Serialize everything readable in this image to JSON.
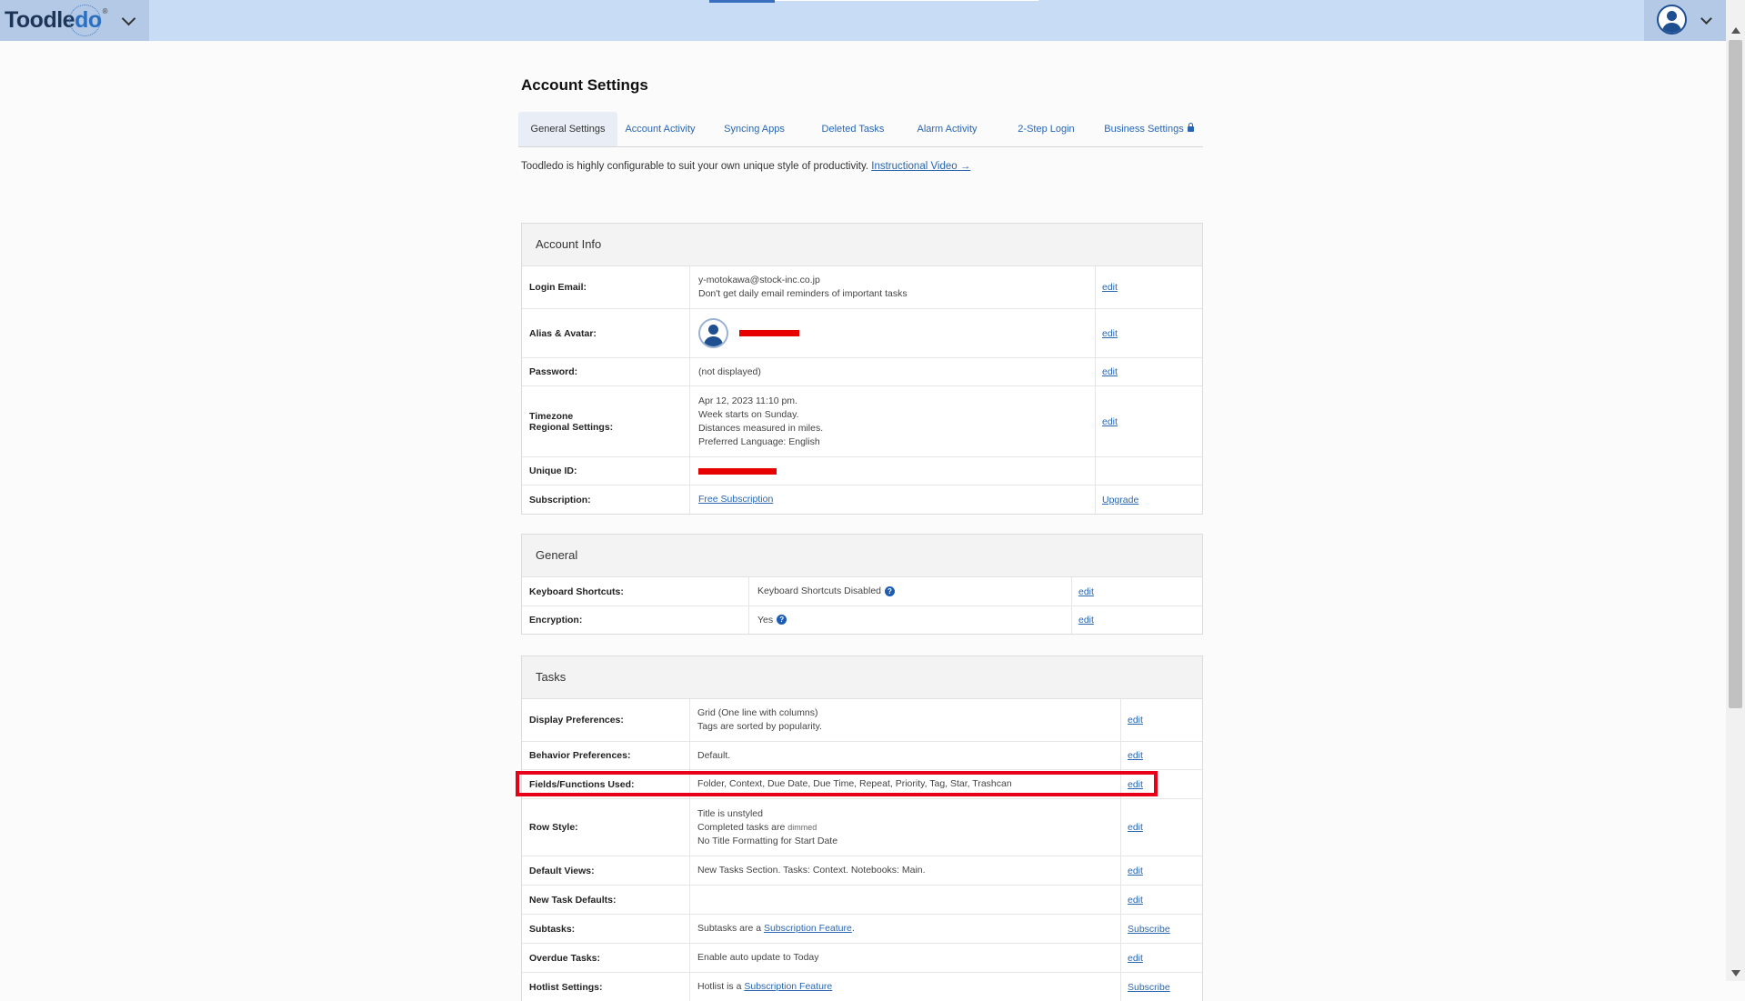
{
  "brand": {
    "name_part1": "Toodle",
    "name_part2": "do",
    "tm": "®"
  },
  "page": {
    "title": "Account Settings",
    "intro_text": "Toodledo is highly configurable to suit your own unique style of productivity.",
    "intro_link": "Instructional Video →"
  },
  "tabs": [
    {
      "label": "General Settings",
      "active": true
    },
    {
      "label": "Account Activity"
    },
    {
      "label": "Syncing Apps"
    },
    {
      "label": "Deleted Tasks"
    },
    {
      "label": "Alarm Activity"
    },
    {
      "label": "2-Step Login"
    },
    {
      "label": "Business Settings",
      "icon": "lock-icon"
    }
  ],
  "account_info": {
    "header": "Account Info",
    "rows": {
      "login_email": {
        "label": "Login Email:",
        "line1": "y-motokawa@stock-inc.co.jp",
        "line2": "Don't get daily email reminders of important tasks",
        "action": "edit"
      },
      "alias": {
        "label": "Alias & Avatar:",
        "action": "edit"
      },
      "password": {
        "label": "Password:",
        "value": "(not displayed)",
        "action": "edit"
      },
      "timezone": {
        "label1": "Timezone",
        "label2": "Regional Settings:",
        "line1": "Apr 12, 2023 11:10 pm.",
        "line2": "Week starts on Sunday.",
        "line3": "Distances measured in miles.",
        "line4": "Preferred Language: English",
        "action": "edit"
      },
      "unique_id": {
        "label": "Unique ID:"
      },
      "subscription": {
        "label": "Subscription:",
        "value": "Free Subscription",
        "action": "Upgrade"
      }
    }
  },
  "general": {
    "header": "General",
    "rows": {
      "keyboard": {
        "label": "Keyboard Shortcuts:",
        "value": "Keyboard Shortcuts Disabled",
        "action": "edit"
      },
      "encryption": {
        "label": "Encryption:",
        "value": "Yes",
        "action": "edit"
      }
    }
  },
  "tasks": {
    "header": "Tasks",
    "rows": {
      "display": {
        "label": "Display Preferences:",
        "line1": "Grid (One line with columns)",
        "line2": "Tags are sorted by popularity.",
        "action": "edit"
      },
      "behavior": {
        "label": "Behavior Preferences:",
        "value": "Default.",
        "action": "edit"
      },
      "fields": {
        "label": "Fields/Functions Used:",
        "value": "Folder, Context, Due Date, Due Time, Repeat, Priority, Tag, Star, Trashcan",
        "action": "edit"
      },
      "row_style": {
        "label": "Row Style:",
        "line1": "Title is unstyled",
        "line2_prefix": "Completed tasks are",
        "line2_dim": "dimmed",
        "line3": "No Title Formatting for Start Date",
        "action": "edit"
      },
      "default_views": {
        "label": "Default Views:",
        "value": "New Tasks Section. Tasks: Context. Notebooks: Main.",
        "action": "edit"
      },
      "new_task": {
        "label": "New Task Defaults:",
        "action": "edit"
      },
      "subtasks": {
        "label": "Subtasks:",
        "prefix": "Subtasks are a",
        "link": "Subscription Feature",
        "suffix": ".",
        "action": "Subscribe"
      },
      "overdue": {
        "label": "Overdue Tasks:",
        "value": "Enable auto update to Today",
        "action": "edit"
      },
      "hotlist": {
        "label": "Hotlist Settings:",
        "prefix": "Hotlist is a",
        "link": "Subscription Feature",
        "action": "Subscribe"
      }
    }
  },
  "colors": {
    "accent": "#2a66b0",
    "topbar": "#c9dcf5",
    "highlight": "#e8001a",
    "redaction": "#e60000"
  }
}
